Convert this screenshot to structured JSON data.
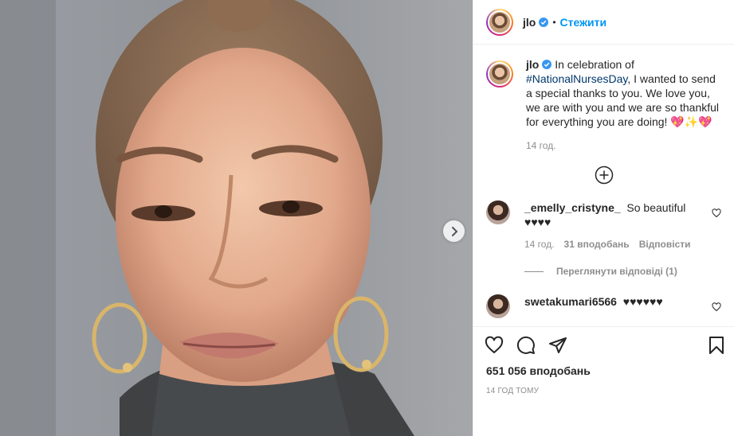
{
  "header": {
    "username": "jlo",
    "separator": "•",
    "follow_label": "Стежити"
  },
  "caption": {
    "username": "jlo",
    "text_before_tag": "In celebration of ",
    "hashtag": "#NationalNursesDay",
    "text_after_tag": ", I wanted to send a special thanks to you. We love you, we are with you and we are so thankful for everything you are doing! 💖✨💖",
    "time": "14 год."
  },
  "comments": [
    {
      "username": "_emelly_cristyne_",
      "text": "So beautiful ♥♥♥♥",
      "time": "14 год.",
      "likes": "31 вподобань",
      "reply_label": "Відповісти",
      "view_replies": "Переглянути відповіді (1)"
    },
    {
      "username": "swetakumari6566",
      "text": "♥♥♥♥♥♥"
    }
  ],
  "actions": {
    "like_icon": "heart-icon",
    "comment_icon": "comment-icon",
    "share_icon": "share-icon",
    "save_icon": "bookmark-icon"
  },
  "likes_count": "651 056 вподобань",
  "timestamp": "14 год тому",
  "colors": {
    "accent": "#0095f6",
    "hashtag": "#00376b",
    "muted": "#8e8e8e"
  }
}
